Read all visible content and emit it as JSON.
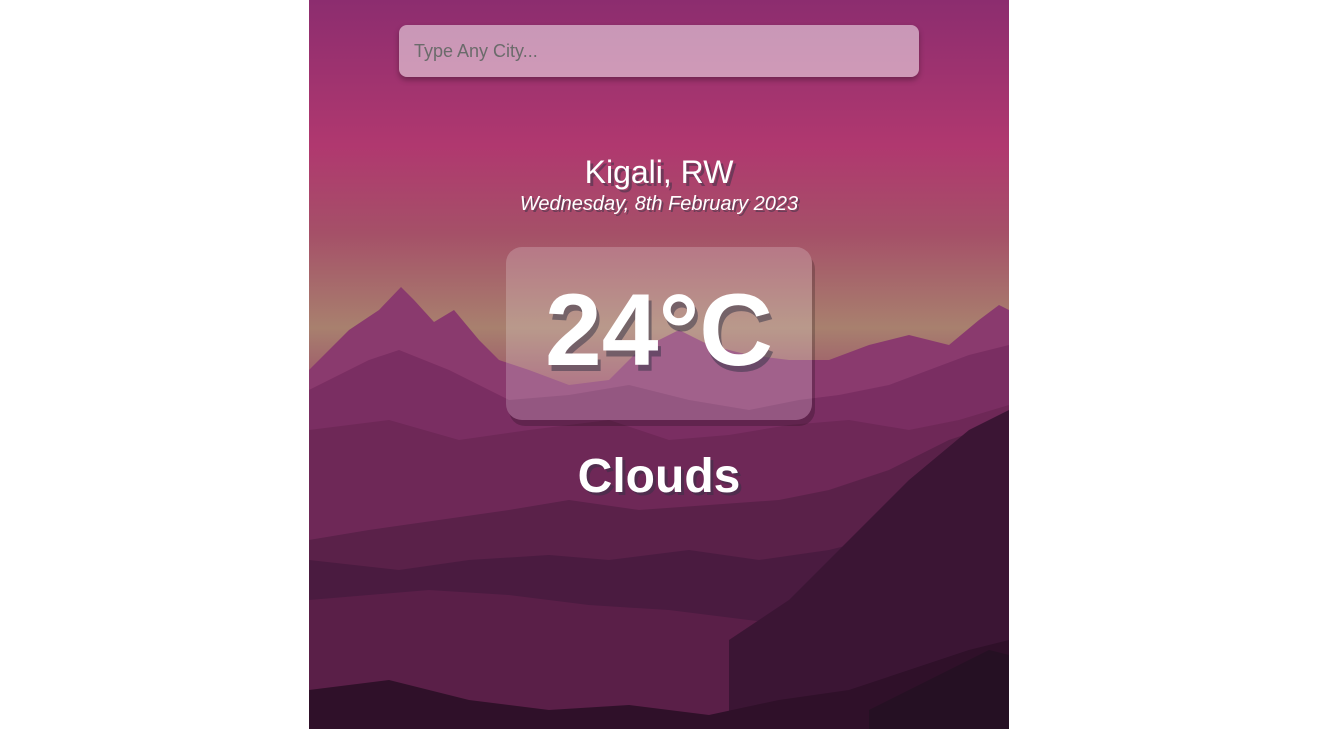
{
  "search": {
    "placeholder": "Type Any City...",
    "value": ""
  },
  "location": {
    "city_country": "Kigali, RW",
    "date": "Wednesday, 8th February 2023"
  },
  "weather": {
    "temperature": "24°C",
    "condition": "Clouds"
  },
  "colors": {
    "sky_top": "#8b2d6e",
    "sky_band": "#b0386f",
    "horizon_glow": "#a8806e",
    "mountain_far": "#8a3a6e",
    "mountain_mid": "#5e2249",
    "mountain_near": "#3d1636",
    "foreground": "#2a1128"
  }
}
